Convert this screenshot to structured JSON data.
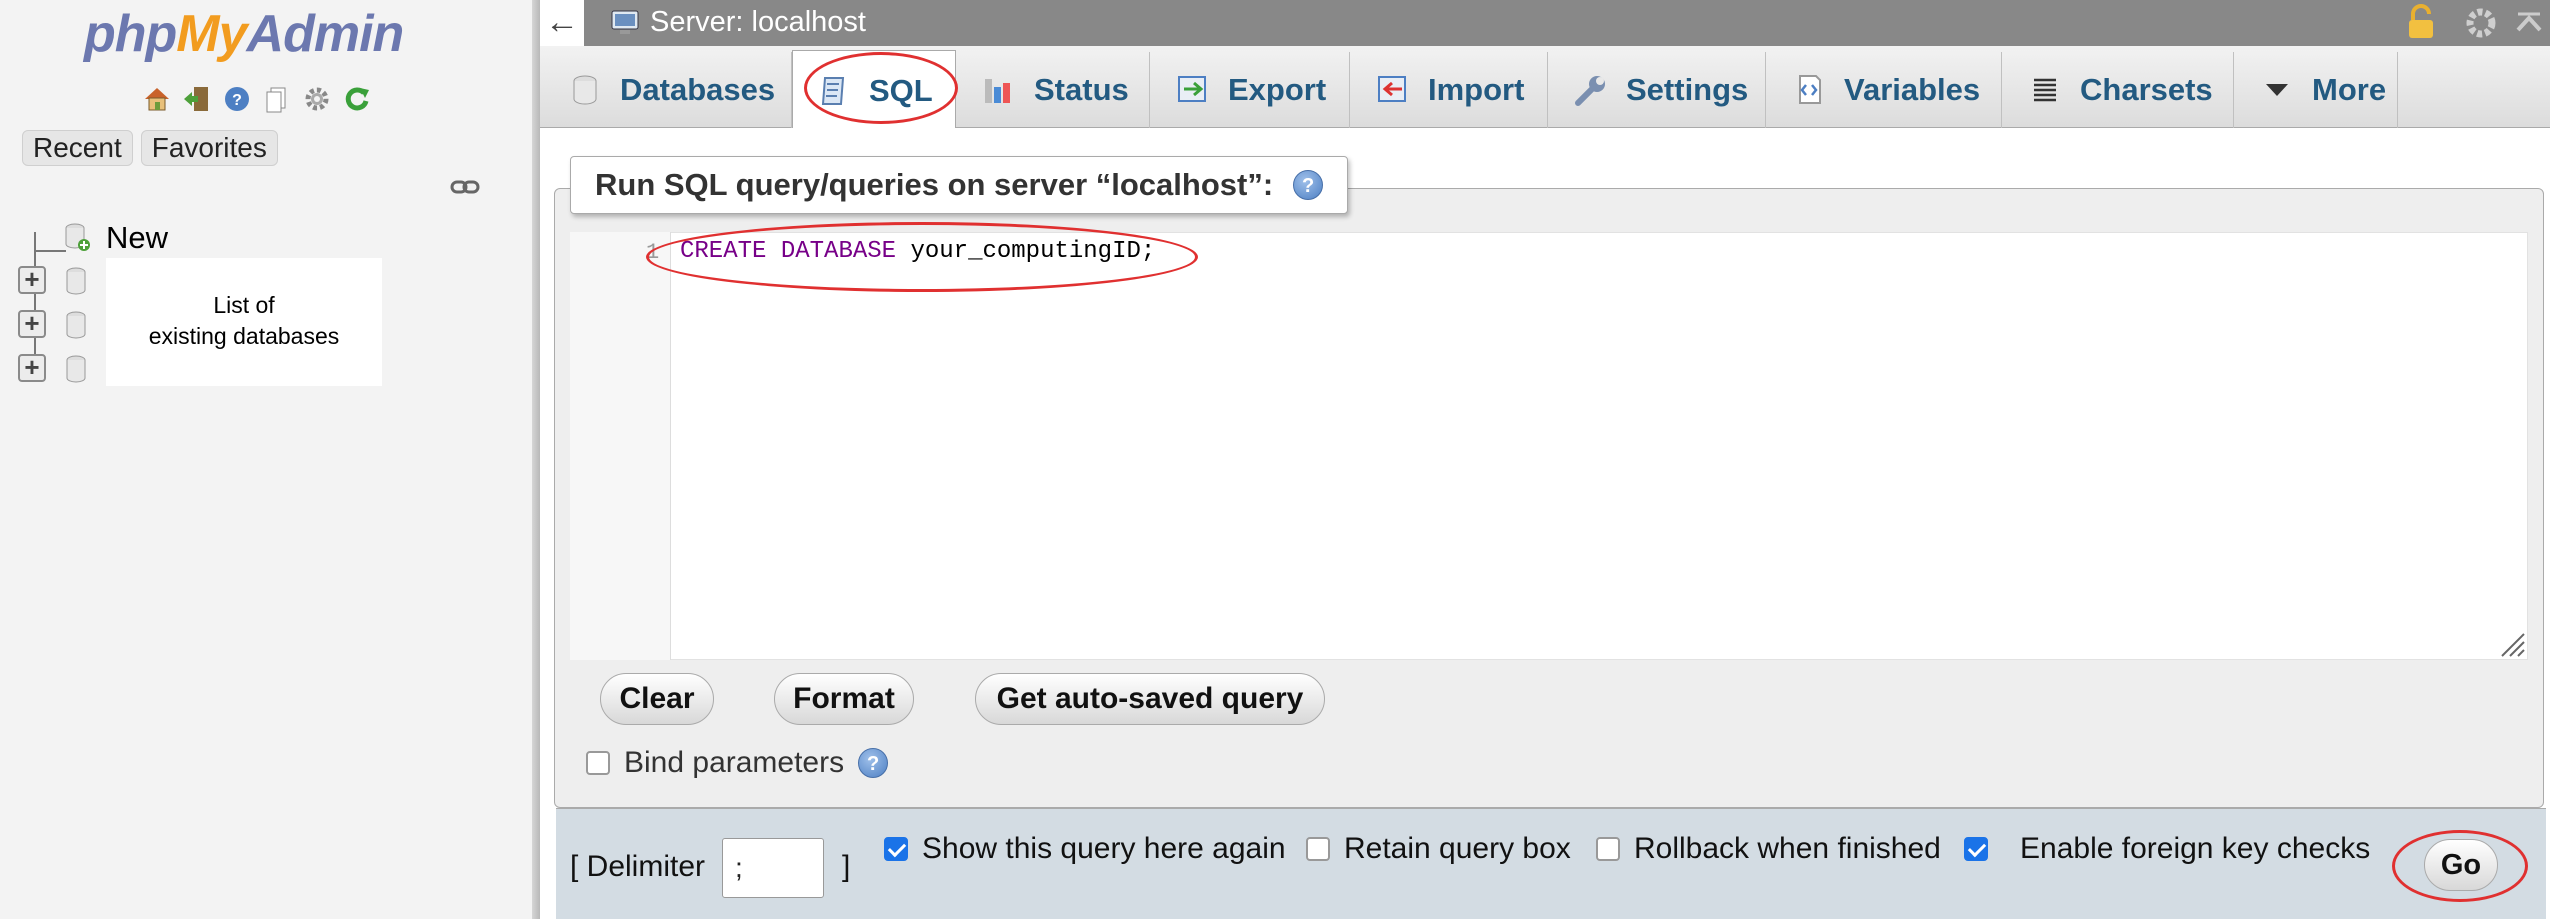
{
  "sidebar": {
    "logo": {
      "php": "php",
      "my": "My",
      "admin": "Admin"
    },
    "nav_icons": [
      "home-icon",
      "exit-icon",
      "help-icon",
      "docs-icon",
      "settings-icon",
      "reload-icon"
    ],
    "recent_label": "Recent",
    "favorites_label": "Favorites",
    "tree": {
      "new_label": "New",
      "db_list_note_line1": "List of",
      "db_list_note_line2": "existing databases"
    }
  },
  "topbar": {
    "back_glyph": "←",
    "server_title": "Server: localhost"
  },
  "tabs": [
    {
      "label": "Databases",
      "icon": "database-icon"
    },
    {
      "label": "SQL",
      "icon": "sql-icon",
      "active": true
    },
    {
      "label": "Status",
      "icon": "status-chart-icon"
    },
    {
      "label": "Export",
      "icon": "export-icon"
    },
    {
      "label": "Import",
      "icon": "import-icon"
    },
    {
      "label": "Settings",
      "icon": "wrench-icon"
    },
    {
      "label": "Variables",
      "icon": "variables-icon"
    },
    {
      "label": "Charsets",
      "icon": "charsets-icon"
    },
    {
      "label": "More",
      "icon": "chevron-down-icon"
    }
  ],
  "query_panel": {
    "legend": "Run SQL query/queries on server “localhost”:",
    "editor": {
      "line_number": "1",
      "kw1": "CREATE",
      "kw2": "DATABASE",
      "ident": "your_computingID;"
    },
    "buttons": {
      "clear": "Clear",
      "format": "Format",
      "autosaved": "Get auto-saved query"
    },
    "bind_parameters_label": "Bind parameters"
  },
  "footer": {
    "delimiter_open": "[ Delimiter",
    "delimiter_value": ";",
    "delimiter_close": "]",
    "options": [
      {
        "label": "Show this query here again",
        "checked": true
      },
      {
        "label": "Retain query box",
        "checked": false
      },
      {
        "label": "Rollback when finished",
        "checked": false
      },
      {
        "label": "Enable foreign key checks",
        "checked": true
      }
    ],
    "go_label": "Go"
  },
  "colors": {
    "accent_tab_text": "#235a81",
    "annotation_red": "#e03030",
    "sql_keyword": "#770088",
    "checkbox_checked": "#1a73e8"
  }
}
